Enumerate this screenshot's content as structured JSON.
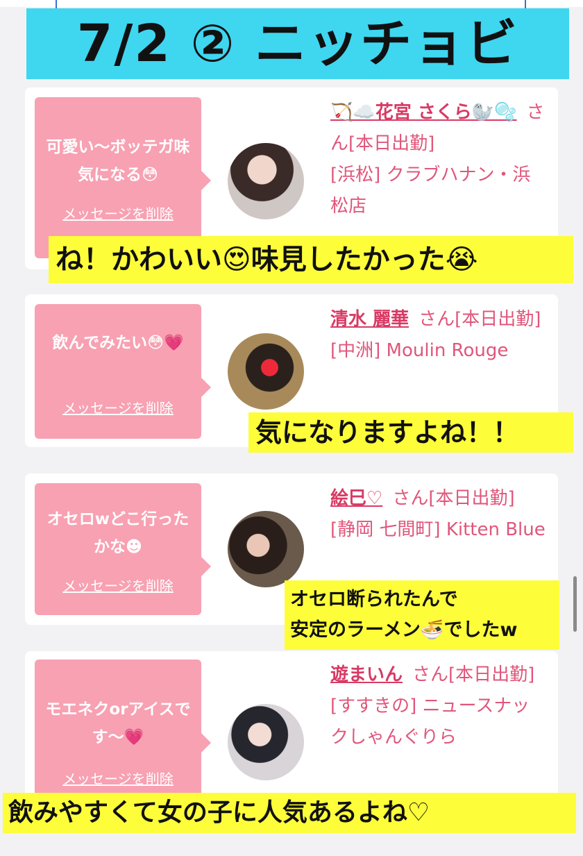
{
  "title": "7/2 ② ニッチョビ",
  "cards": [
    {
      "message": "可愛い〜ボッテガ味気になる😳",
      "delete_label": "メッセージを削除",
      "name": "🏹☁️花宮 さくら🦭🫧",
      "suffix": "さん[本日出勤]",
      "shop": "[浜松] クラブハナン・浜松店",
      "caption": "ね！かわいい😍味見したかった😭"
    },
    {
      "message": "飲んでみたい😳💗",
      "delete_label": "メッセージを削除",
      "name": "清水 麗華",
      "suffix": "さん[本日出勤]",
      "shop": "[中洲] Moulin Rouge",
      "caption": "気になりますよね！！"
    },
    {
      "message": "オセロwどこ行ったかな☻",
      "delete_label": "メッセージを削除",
      "name": "絵巳♡",
      "suffix": "さん[本日出勤]",
      "shop": "[静岡 七間町] Kitten Blue",
      "caption_line1": "オセロ断られたんで",
      "caption_line2": "安定のラーメン🍜でしたw"
    },
    {
      "message": "モエネクorアイスです〜💗",
      "delete_label": "メッセージを削除",
      "name": "遊まいん",
      "suffix": "さん[本日出勤]",
      "shop": "[すすきの] ニュースナックしゃんぐりら",
      "caption": "飲みやすくて女の子に人気あるよね♡"
    }
  ],
  "colors": {
    "banner": "#3fd6f0",
    "bubble": "#f7a1b2",
    "name": "#d83a64",
    "caption_bg": "#fdfd3a"
  }
}
